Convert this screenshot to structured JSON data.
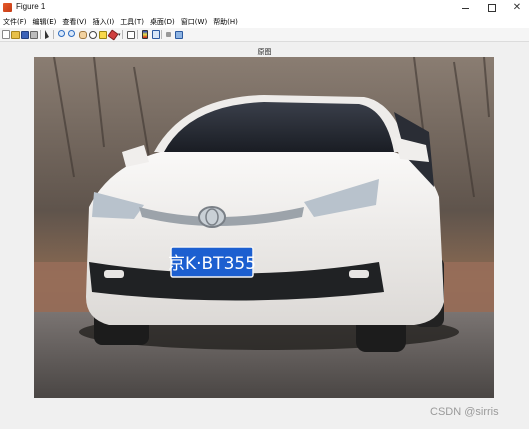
{
  "window": {
    "title": "Figure 1"
  },
  "menu": {
    "items": [
      {
        "label": "文件(F)"
      },
      {
        "label": "编辑(E)"
      },
      {
        "label": "查看(V)"
      },
      {
        "label": "插入(I)"
      },
      {
        "label": "工具(T)"
      },
      {
        "label": "桌面(D)"
      },
      {
        "label": "窗口(W)"
      },
      {
        "label": "帮助(H)"
      }
    ]
  },
  "axes": {
    "title": "原图"
  },
  "image": {
    "plate_text": "京K·BT355",
    "plate_color": "#1c5fd0",
    "car_color": "#f2f0ee",
    "background_color": "#6f6459"
  },
  "watermark": {
    "text": "CSDN @sirris"
  }
}
